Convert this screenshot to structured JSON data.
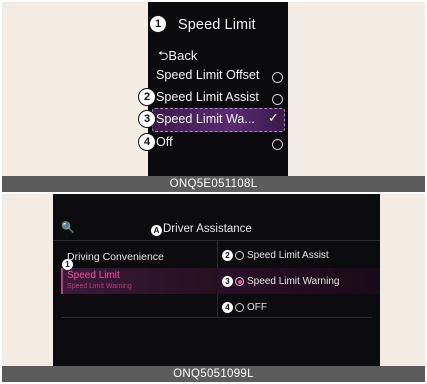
{
  "top_panel": {
    "cluster": {
      "title": "Speed Limit",
      "back": "Back",
      "back_icon": "⮌",
      "options": [
        {
          "label": "Speed Limit Offset",
          "state": "unselected"
        },
        {
          "label": "Speed Limit Assist",
          "state": "unselected"
        },
        {
          "label": "Speed Limit Wa...",
          "state": "selected"
        },
        {
          "label": "Off",
          "state": "unselected"
        }
      ],
      "check_icon": "✓"
    },
    "callouts": [
      "1",
      "2",
      "3",
      "4"
    ],
    "caption": "ONQ5E051108L"
  },
  "bottom_panel": {
    "screen": {
      "search_icon": "🔍",
      "title_badge": "A",
      "title": "Driver Assistance",
      "left_menu": {
        "category": "Driving Convenience",
        "item": "Speed Limit",
        "item_sub": "Speed Limit Warning",
        "badge": "1"
      },
      "options": [
        {
          "badge": "2",
          "label": "Speed Limit Assist",
          "selected": false
        },
        {
          "badge": "3",
          "label": "Speed Limit Warning",
          "selected": true
        },
        {
          "badge": "4",
          "label": "OFF",
          "selected": false
        }
      ]
    },
    "caption": "ONQ5051099L"
  },
  "colors": {
    "background": "#f2ece4",
    "screen": "#0c0c0e",
    "accent_pink": "#ff4aa8",
    "accent_purple": "#5a2a72",
    "caption_bar": "#5c5c5c"
  }
}
